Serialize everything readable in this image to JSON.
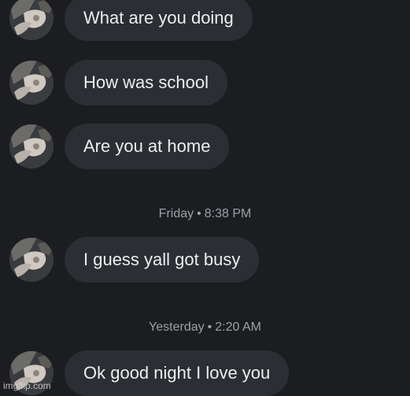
{
  "messages": [
    {
      "text": "What are you doing"
    },
    {
      "text": "How was school"
    },
    {
      "text": "Are you at home"
    },
    {
      "text": "I guess yall got busy"
    },
    {
      "text": "Ok good night I love you"
    }
  ],
  "timestamps": [
    {
      "day": "Friday",
      "separator": "•",
      "time": "8:38 PM"
    },
    {
      "day": "Yesterday",
      "separator": "•",
      "time": "2:20 AM"
    }
  ],
  "watermark": "imgflip.com",
  "colors": {
    "background": "#1c1d21",
    "bubble": "#2d2e33",
    "message_text": "#eceef0",
    "timestamp_text": "#9aa0a6"
  }
}
